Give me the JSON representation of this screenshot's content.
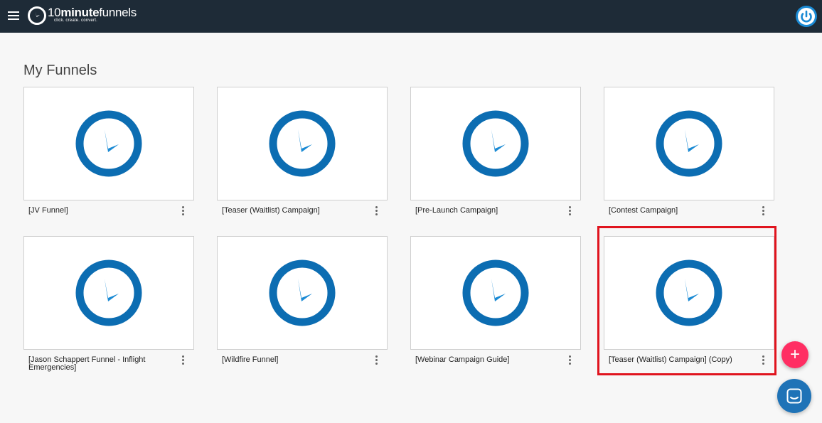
{
  "app": {
    "logo_prefix": "10",
    "logo_bold": "minute",
    "logo_suffix": "funnels",
    "logo_tagline": "click. create. convert."
  },
  "icons": {
    "menu": "hamburger-icon",
    "logo": "clock-logo-icon",
    "power": "power-icon",
    "thumbnail": "clock-icon",
    "card_menu": "more-vertical-icon",
    "add": "plus-icon",
    "chat": "chat-icon"
  },
  "colors": {
    "topbar": "#1e2b37",
    "brand_blue": "#0c6db2",
    "accent_pink": "#ff2e63",
    "highlight": "#e0141e"
  },
  "page": {
    "title": "My Funnels"
  },
  "funnels": [
    {
      "name": "[JV Funnel]"
    },
    {
      "name": "[Teaser (Waitlist) Campaign]"
    },
    {
      "name": "[Pre-Launch Campaign]"
    },
    {
      "name": "[Contest Campaign]"
    },
    {
      "name": "[Jason Schappert Funnel - Inflight Emergencies]"
    },
    {
      "name": "[Wildfire Funnel]"
    },
    {
      "name": "[Webinar Campaign Guide]"
    },
    {
      "name": "[Teaser (Waitlist) Campaign] (Copy)"
    }
  ],
  "fab": {
    "label": "+"
  }
}
